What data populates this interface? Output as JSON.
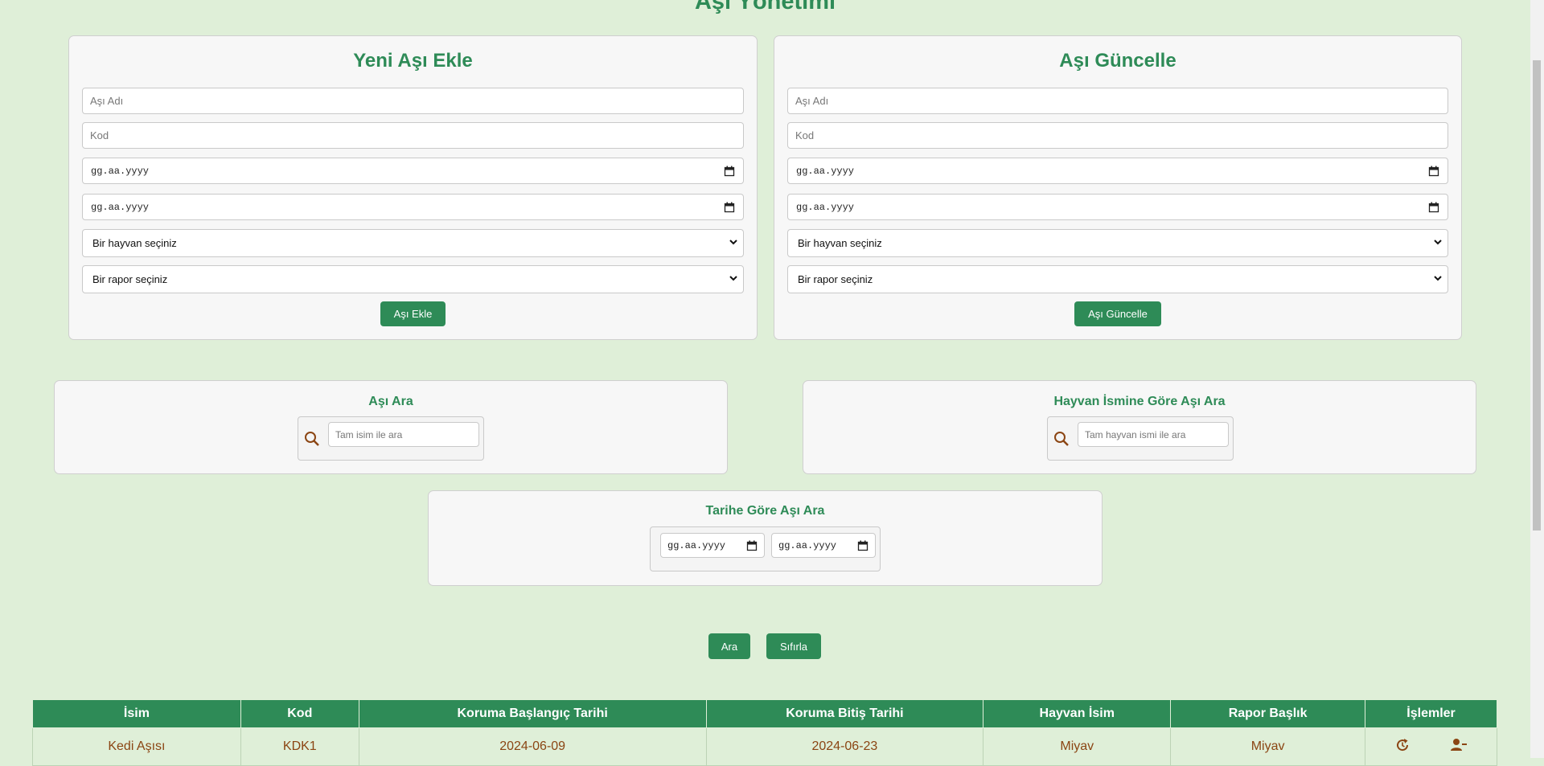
{
  "page": {
    "title": "Aşı Yönetimi"
  },
  "add_form": {
    "title": "Yeni Aşı Ekle",
    "name_placeholder": "Aşı Adı",
    "code_placeholder": "Kod",
    "start_date_placeholder": "gg.aa.yyyy",
    "end_date_placeholder": "gg.aa.yyyy",
    "animal_select": "Bir hayvan seçiniz",
    "report_select": "Bir rapor seçiniz",
    "submit_label": "Aşı Ekle"
  },
  "update_form": {
    "title": "Aşı Güncelle",
    "name_placeholder": "Aşı Adı",
    "code_placeholder": "Kod",
    "start_date_placeholder": "gg.aa.yyyy",
    "end_date_placeholder": "gg.aa.yyyy",
    "animal_select": "Bir hayvan seçiniz",
    "report_select": "Bir rapor seçiniz",
    "submit_label": "Aşı Güncelle"
  },
  "search_name": {
    "title": "Aşı Ara",
    "placeholder": "Tam isim ile ara"
  },
  "search_animal": {
    "title": "Hayvan İsmine Göre Aşı Ara",
    "placeholder": "Tam hayvan ismi ile ara"
  },
  "search_date": {
    "title": "Tarihe Göre Aşı Ara",
    "start_placeholder": "gg.aa.yyyy",
    "end_placeholder": "gg.aa.yyyy"
  },
  "actions": {
    "search_label": "Ara",
    "reset_label": "Sıfırla"
  },
  "table": {
    "headers": [
      "İsim",
      "Kod",
      "Koruma Başlangıç Tarihi",
      "Koruma Bitiş Tarihi",
      "Hayvan İsim",
      "Rapor Başlık",
      "İşlemler"
    ],
    "rows": [
      [
        "Kedi Aşısı",
        "KDK1",
        "2024-06-09",
        "2024-06-23",
        "Miyav",
        "Miyav"
      ]
    ]
  },
  "icons": {
    "search": "search-icon",
    "calendar": "calendar-icon",
    "chevron": "chevron-down-icon",
    "update": "refresh-icon",
    "remove_user": "user-minus-icon"
  },
  "colors": {
    "background": "#dfefd8",
    "primary": "#2e8b57",
    "accent_text": "#8b4513"
  }
}
